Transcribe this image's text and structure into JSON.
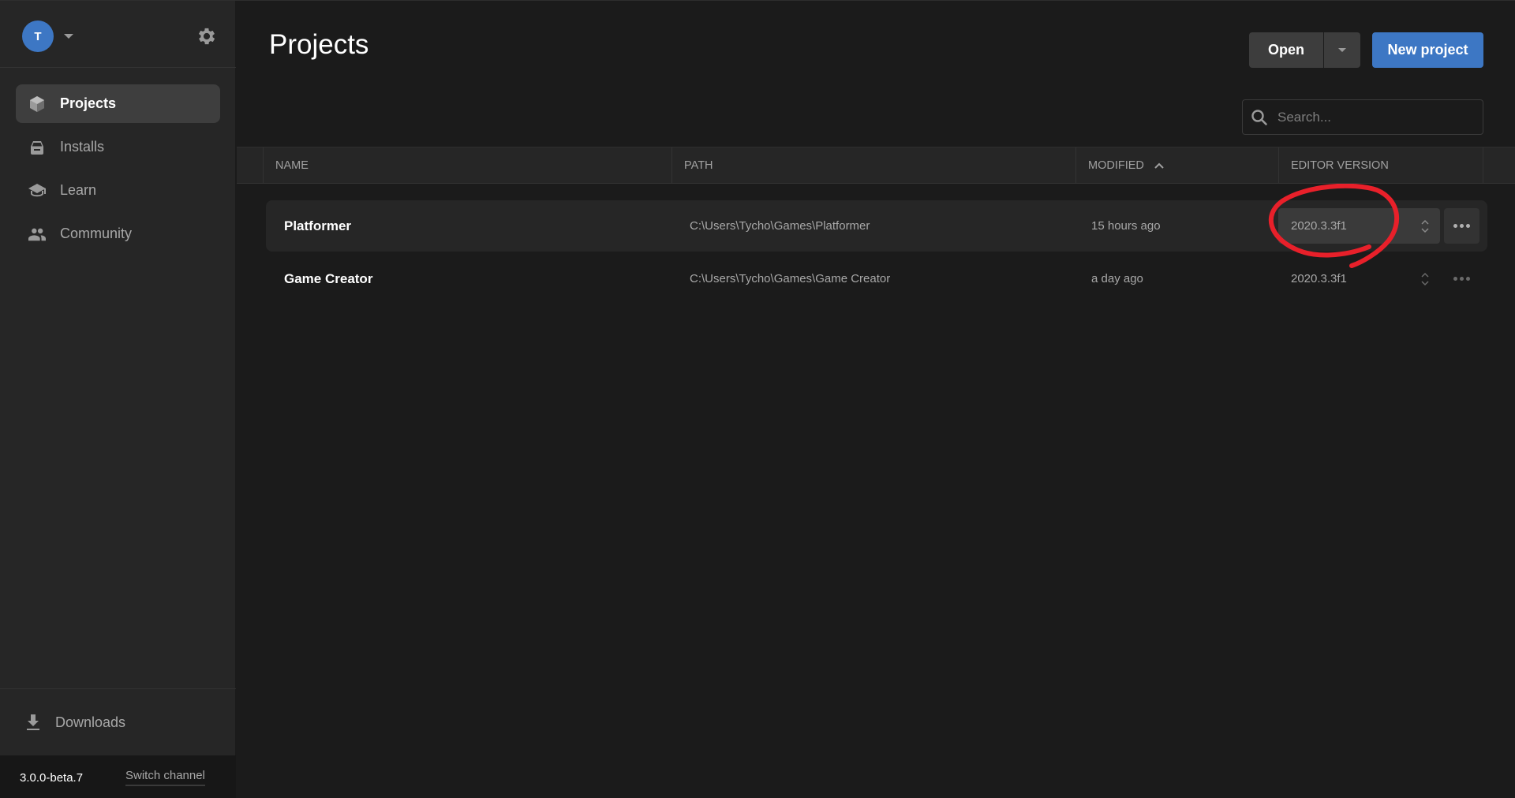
{
  "sidebar": {
    "avatar_initial": "T",
    "nav": [
      {
        "label": "Projects",
        "icon": "cube-icon",
        "active": true
      },
      {
        "label": "Installs",
        "icon": "installs-drive-icon",
        "active": false
      },
      {
        "label": "Learn",
        "icon": "graduation-cap-icon",
        "active": false
      },
      {
        "label": "Community",
        "icon": "people-icon",
        "active": false
      }
    ],
    "downloads_label": "Downloads",
    "version": "3.0.0-beta.7",
    "switch_channel_label": "Switch channel"
  },
  "main": {
    "title": "Projects",
    "open_label": "Open",
    "new_project_label": "New project",
    "search_placeholder": "Search...",
    "columns": [
      {
        "label": "NAME"
      },
      {
        "label": "PATH"
      },
      {
        "label": "MODIFIED",
        "sort": "ascending"
      },
      {
        "label": "EDITOR VERSION"
      }
    ],
    "projects": [
      {
        "name": "Platformer",
        "path": "C:\\Users\\Tycho\\Games\\Platformer",
        "modified": "15 hours ago",
        "editor_version": "2020.3.3f1",
        "selected": true
      },
      {
        "name": "Game Creator",
        "path": "C:\\Users\\Tycho\\Games\\Game Creator",
        "modified": "a day ago",
        "editor_version": "2020.3.3f1",
        "selected": false
      }
    ]
  },
  "colors": {
    "accent": "#3d77c4",
    "annotation": "#e8202a",
    "sidebar_bg": "#262626",
    "main_bg": "#1b1b1b"
  }
}
